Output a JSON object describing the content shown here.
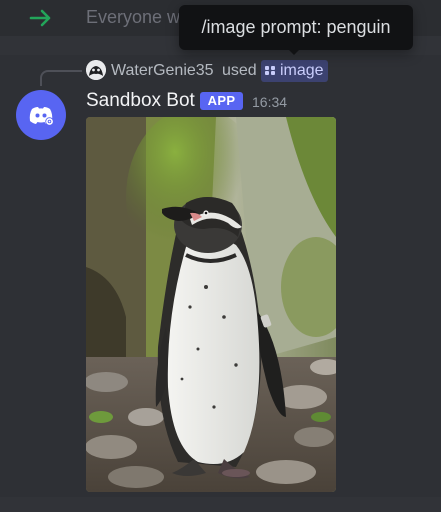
{
  "previous_message": {
    "text": "Everyone w",
    "icon": "join-arrow-icon"
  },
  "tooltip": {
    "text": "/image prompt: penguin"
  },
  "reply": {
    "username": "WaterGenie35",
    "used_label": "used",
    "command": "image",
    "command_icon": "slash-command-icon"
  },
  "message": {
    "author": "Sandbox Bot",
    "badge": "APP",
    "timestamp": "16:34",
    "attachment": "penguin-image"
  },
  "colors": {
    "background": "#313338",
    "blurple": "#5865f2",
    "join_green": "#23a55a",
    "tooltip_bg": "#111214",
    "command_chip": "#3c4270"
  }
}
